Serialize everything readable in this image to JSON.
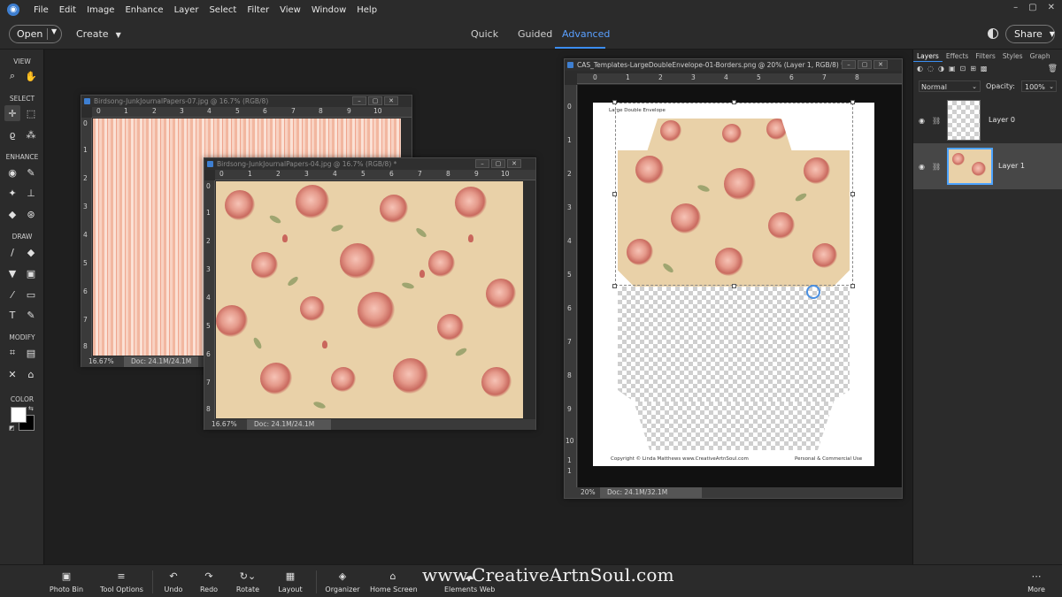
{
  "menubar": {
    "items": [
      "File",
      "Edit",
      "Image",
      "Enhance",
      "Layer",
      "Select",
      "Filter",
      "View",
      "Window",
      "Help"
    ],
    "window_controls": [
      "–",
      "▢",
      "✕"
    ]
  },
  "modebar": {
    "open_label": "Open",
    "create_label": "Create",
    "modes": [
      "Quick",
      "Guided",
      "Advanced"
    ],
    "active_mode": "Advanced",
    "share_label": "Share"
  },
  "toolbox": {
    "sections": [
      "VIEW",
      "SELECT",
      "ENHANCE",
      "DRAW",
      "MODIFY",
      "COLOR"
    ],
    "tools": {
      "zoom": "⌕",
      "hand": "✋",
      "move": "✛",
      "marquee": "⬚",
      "lasso": "ϱ",
      "quick_select": "⁂",
      "eye": "◉",
      "spot_heal": "✎",
      "smart_brush": "✦",
      "clone": "⊥",
      "blur": "◆",
      "sponge": "⊛",
      "brush": "/",
      "eraser": "◆",
      "paint_bucket": "▼",
      "gradient": "▣",
      "eyedropper": "⁄",
      "shape": "▭",
      "type": "T",
      "pencil": "✎",
      "crop": "⌗",
      "recompose": "▤",
      "content_move": "✕",
      "straighten": "⌂"
    },
    "foreground_color": "#ffffff",
    "background_color": "#000000"
  },
  "docs": {
    "doc1": {
      "title": "Birdsong-JunkJournalPapers-07.jpg @ 16.7% (RGB/8)",
      "zoom": "16.67%",
      "docsize": "Doc: 24.1M/24.1M",
      "ruler_h": [
        "0",
        "1",
        "2",
        "3",
        "4",
        "5",
        "6",
        "7",
        "8",
        "9",
        "10"
      ],
      "ruler_v": [
        "0",
        "1",
        "2",
        "3",
        "4",
        "5",
        "6",
        "7",
        "8"
      ]
    },
    "doc2": {
      "title": "Birdsong-JunkJournalPapers-04.jpg @ 16.7% (RGB/8) *",
      "zoom": "16.67%",
      "docsize": "Doc: 24.1M/24.1M",
      "ruler_h": [
        "0",
        "1",
        "2",
        "3",
        "4",
        "5",
        "6",
        "7",
        "8",
        "9",
        "10"
      ],
      "ruler_v": [
        "0",
        "1",
        "2",
        "3",
        "4",
        "5",
        "6",
        "7",
        "8"
      ]
    },
    "doc3": {
      "title": "CAS_Templates-LargeDoubleEnvelope-01-Borders.png @ 20% (Layer 1, RGB/8) *",
      "zoom": "20%",
      "docsize": "Doc: 24.1M/32.1M",
      "ruler_h": [
        "0",
        "1",
        "2",
        "3",
        "4",
        "5",
        "6",
        "7",
        "8"
      ],
      "ruler_v": [
        "0",
        "1",
        "2",
        "3",
        "4",
        "5",
        "6",
        "7",
        "8",
        "9",
        "10",
        "1",
        "1"
      ],
      "paper_header": "Large Double Envelope",
      "paper_copyright": "Copyright © Linda Matthews www.CreativeArtnSoul.com",
      "paper_use": "Personal & Commercial Use"
    }
  },
  "layers_panel": {
    "tabs": [
      "Layers",
      "Effects",
      "Filters",
      "Styles",
      "Graph"
    ],
    "active_tab": "Layers",
    "blend_mode": "Normal",
    "opacity_label": "Opacity:",
    "opacity_value": "100%",
    "layers": [
      {
        "name": "Layer 0",
        "selected": false
      },
      {
        "name": "Layer 1",
        "selected": true
      }
    ]
  },
  "taskbar": {
    "items": [
      {
        "label": "Photo Bin",
        "icon": "▣"
      },
      {
        "label": "Tool Options",
        "icon": "≡"
      },
      {
        "label": "Undo",
        "icon": "↶"
      },
      {
        "label": "Redo",
        "icon": "↷"
      },
      {
        "label": "Rotate",
        "icon": "↻⌄"
      },
      {
        "label": "Layout",
        "icon": "▦"
      },
      {
        "label": "Organizer",
        "icon": "◈"
      },
      {
        "label": "Home Screen",
        "icon": "⌂"
      },
      {
        "label": "Elements Web",
        "icon": "☁"
      },
      {
        "label": "More",
        "icon": "⋯"
      }
    ]
  },
  "watermark": "www.CreativeArtnSoul.com",
  "colors": {
    "accent": "#3b8df0",
    "panel_bg": "#2b2b2b",
    "canvas_bg": "#1f1f1f"
  }
}
